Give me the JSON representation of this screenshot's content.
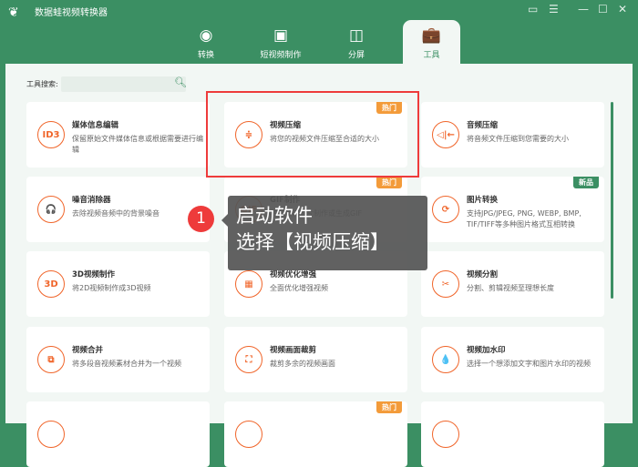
{
  "app": {
    "title": "数据蛙视频转换器"
  },
  "tabs": [
    {
      "label": "转换",
      "icon": "convert-icon"
    },
    {
      "label": "短视频制作",
      "icon": "tv-icon"
    },
    {
      "label": "分屏",
      "icon": "split-screen-icon"
    },
    {
      "label": "工具",
      "icon": "toolbox-icon",
      "active": true
    }
  ],
  "search": {
    "label": "工具搜索:",
    "value": ""
  },
  "tools": [
    {
      "title": "媒体信息编辑",
      "desc": "保留原始文件媒体信息或根据需要进行编辑",
      "icon": "ID3"
    },
    {
      "title": "视频压缩",
      "desc": "将您的视频文件压缩至合适的大小",
      "icon": "≑",
      "tag": "热门"
    },
    {
      "title": "音频压缩",
      "desc": "将音频文件压缩到您需要的大小",
      "icon": "◁|←"
    },
    {
      "title": "噪音消除器",
      "desc": "去除视频音频中的背景噪音",
      "icon": "🎧"
    },
    {
      "title": "GIF制作",
      "desc": "将视频或图片制作或生成GIF",
      "icon": "GIF",
      "tag": "热门"
    },
    {
      "title": "图片转换",
      "desc": "支持JPG/JPEG, PNG, WEBP, BMP, TIF/TIFF等多种图片格式互相转换",
      "icon": "⟳",
      "tag": "新品"
    },
    {
      "title": "3D视频制作",
      "desc": "将2D视频制作成3D视频",
      "icon": "3D"
    },
    {
      "title": "视频优化增强",
      "desc": "全面优化增强视频",
      "icon": "▦"
    },
    {
      "title": "视频分割",
      "desc": "分割、剪辑视频至理想长度",
      "icon": "✂"
    },
    {
      "title": "视频合并",
      "desc": "将多段音视频素材合并为一个视频",
      "icon": "⧉"
    },
    {
      "title": "视频画面裁剪",
      "desc": "裁剪多余的视频画面",
      "icon": "⛶"
    },
    {
      "title": "视频加水印",
      "desc": "选择一个想添加文字和图片水印的视频",
      "icon": "💧"
    },
    {
      "title": "",
      "desc": "",
      "icon": ""
    },
    {
      "title": "",
      "desc": "",
      "icon": "",
      "tag": "热门"
    },
    {
      "title": "",
      "desc": "",
      "icon": ""
    }
  ],
  "tooltip": {
    "step": "1",
    "line1": "启动软件",
    "line2": "选择【视频压缩】"
  }
}
